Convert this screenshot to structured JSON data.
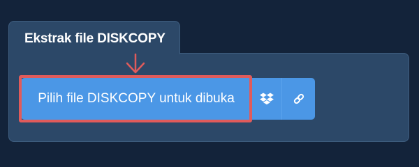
{
  "panel": {
    "title": "Ekstrak file DISKCOPY"
  },
  "upload": {
    "button_label": "Pilih file DISKCOPY untuk dibuka",
    "dropbox_icon": "dropbox-icon",
    "link_icon": "link-icon"
  },
  "annotation": {
    "arrow_icon": "arrow-down-icon",
    "highlight_color": "#e05b5b"
  },
  "colors": {
    "background": "#13233a",
    "panel": "#2c4868",
    "button": "#4b97e6",
    "text": "#ffffff"
  }
}
